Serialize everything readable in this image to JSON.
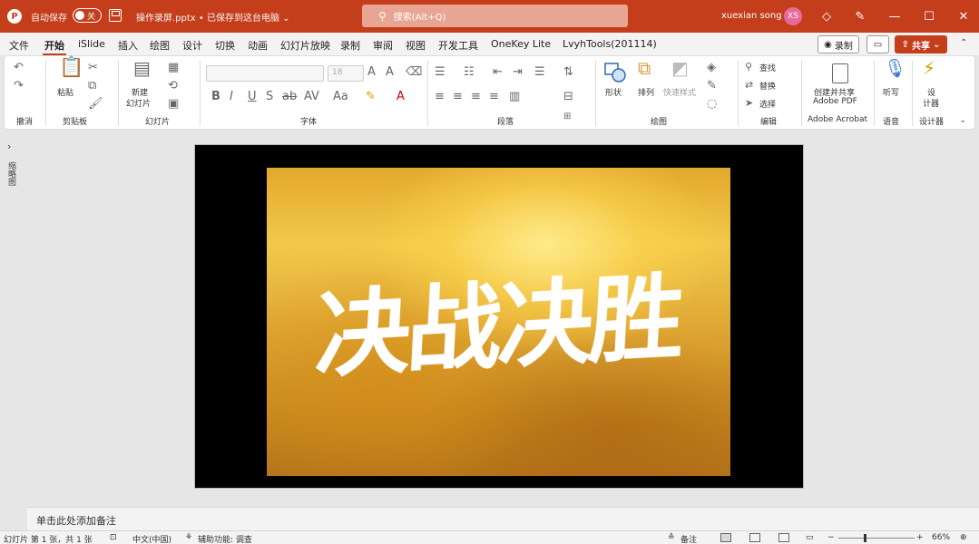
{
  "titlebar": {
    "app_logo": "P",
    "autosave_label": "自动保存",
    "autosave_state": "关",
    "doc_title": "操作录屏.pptx  •  已保存到这台电脑 ⌄",
    "search_placeholder": "搜索(Alt+Q)",
    "user_name": "xuexian song",
    "avatar_initials": "XS",
    "icons": [
      "diamond-icon",
      "pen-icon",
      "minimize-icon",
      "maximize-icon",
      "close-icon"
    ]
  },
  "menu": {
    "tabs": [
      "文件",
      "开始",
      "iSlide",
      "插入",
      "绘图",
      "设计",
      "切换",
      "动画",
      "幻灯片放映",
      "录制",
      "审阅",
      "视图",
      "开发工具",
      "OneKey Lite",
      "LvyhTools(201114)"
    ],
    "active_tab": "开始",
    "record_button": "录制",
    "share_button": "共享"
  },
  "ribbon": {
    "groups": [
      "撤消",
      "剪贴板",
      "幻灯片",
      "字体",
      "段落",
      "绘图",
      "编辑",
      "Adobe Acrobat",
      "语音",
      "设计器"
    ],
    "paste": "粘贴",
    "new_slide": "新建",
    "new_slide_2": "幻灯片",
    "font_size": "18",
    "shape": "形状",
    "arrange": "排列",
    "quick_styles": "快速样式",
    "find": "查找",
    "replace": "替换",
    "select": "选择",
    "acrobat_1": "创建并共享",
    "acrobat_2": "Adobe PDF",
    "dictate": "听写",
    "designer_1": "设",
    "designer_2": "计器"
  },
  "thumbnails": {
    "label": "缩略图"
  },
  "slide": {
    "text": "决战决胜"
  },
  "notes": {
    "placeholder": "单击此处添加备注"
  },
  "status": {
    "slide_info": "幻灯片 第 1 张，共 1 张",
    "language": "中文(中国)",
    "accessibility": "辅助功能: 调查",
    "notes_button": "备注",
    "zoom": "66%"
  }
}
